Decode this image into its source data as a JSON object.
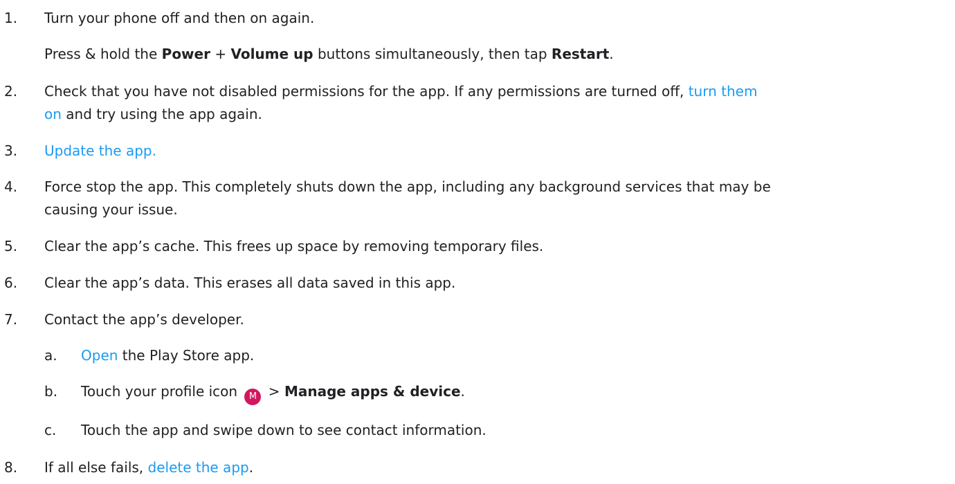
{
  "steps": [
    {
      "num": "1.",
      "text": "Turn your phone off and then on again."
    },
    {
      "detail": {
        "pre": "Press & hold the ",
        "b1": "Power",
        "mid1": " + ",
        "b2": "Volume up",
        "mid2": " buttons simultaneously, then tap ",
        "b3": "Restart",
        "post": "."
      }
    },
    {
      "num": "2.",
      "line1": "Check that you have not disabled permissions for the app. If any permissions are turned off, ",
      "link1": "turn them",
      "link2": "on",
      "line2_post": " and try using the app again."
    },
    {
      "num": "3.",
      "link": "Update the app."
    },
    {
      "num": "4.",
      "line1": "Force stop the app. This completely shuts down the app, including any background services that may be",
      "line2": "causing your issue."
    },
    {
      "num": "5.",
      "text": "Clear the app’s cache. This frees up space by removing temporary files."
    },
    {
      "num": "6.",
      "text": "Clear the app’s data. This erases all data saved in this app."
    },
    {
      "num": "7.",
      "text": "Contact the app’s developer."
    },
    {
      "num": "8.",
      "pre": "If all else fails, ",
      "link": "delete the app",
      "post": "."
    }
  ],
  "substeps": [
    {
      "num": "a.",
      "link": "Open",
      "post": " the Play Store app."
    },
    {
      "num": "b.",
      "pre": "Touch your profile icon ",
      "avatar_letter": "M",
      "mid": " > ",
      "bold": "Manage apps & device",
      "post": "."
    },
    {
      "num": "c.",
      "text": "Touch the app and swipe down to see contact information."
    }
  ],
  "colors": {
    "link": "#1a9bf0",
    "avatar_bg": "#d2175e"
  },
  "icons": {
    "profile": "profile-avatar-icon"
  }
}
